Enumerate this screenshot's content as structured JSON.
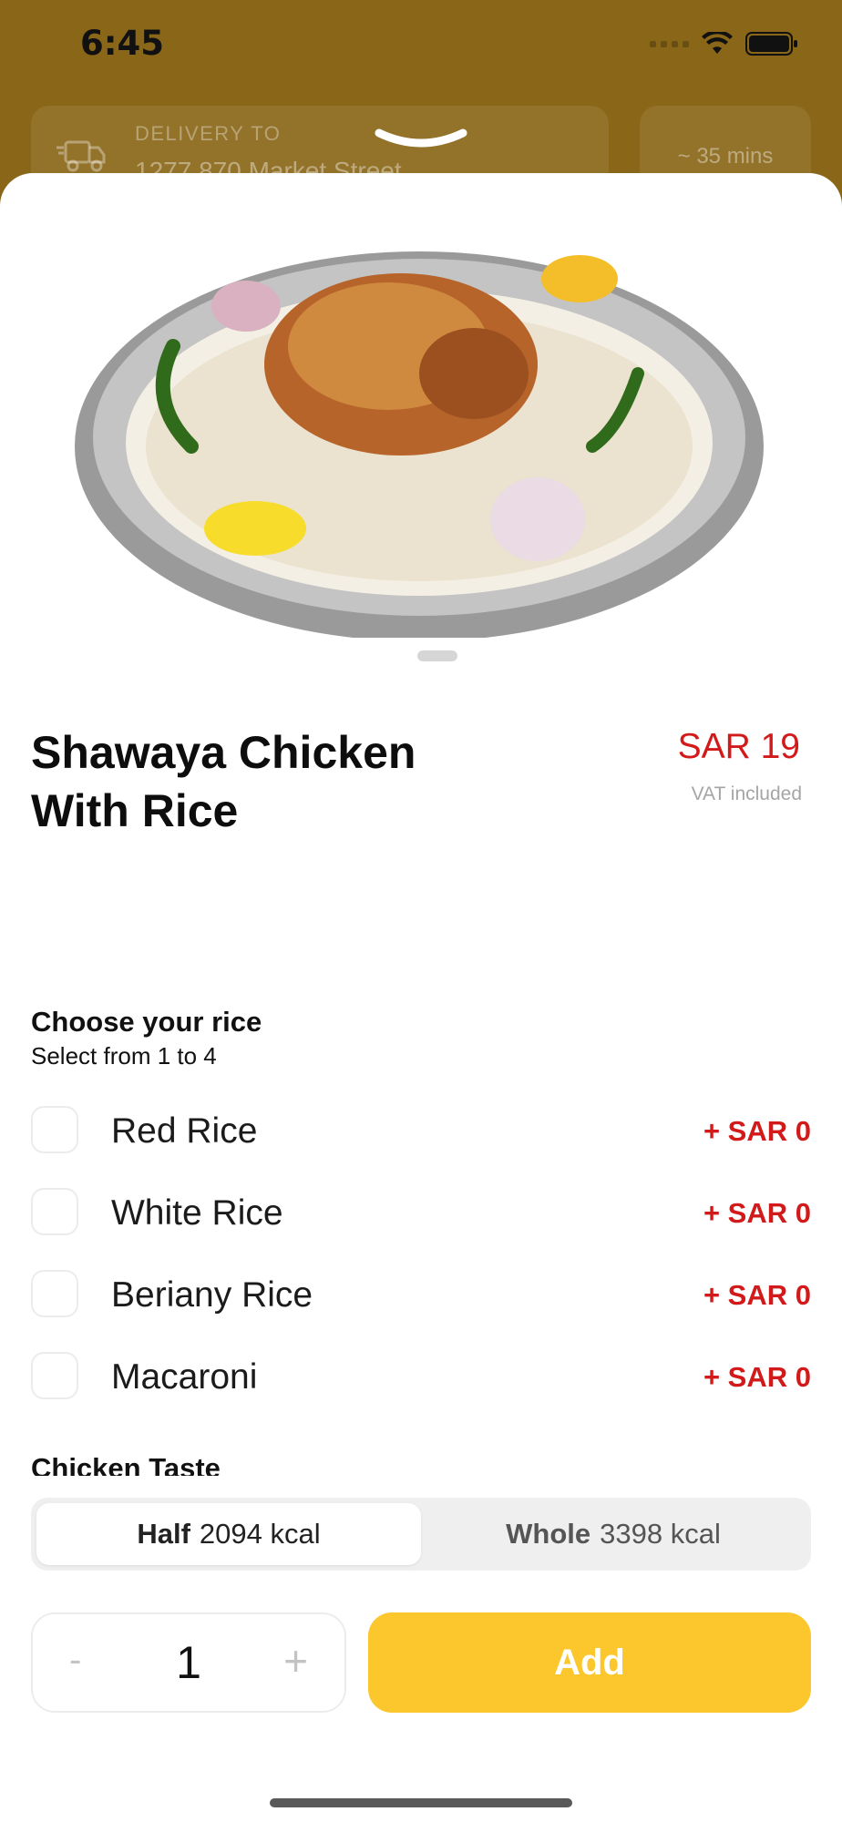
{
  "status": {
    "time": "6:45"
  },
  "header": {
    "delivery_label": "DELIVERY TO",
    "address": "1277 870 Market Street",
    "eta": "~ 35 mins"
  },
  "product": {
    "name": "Shawaya Chicken With Rice",
    "price": "SAR 19",
    "vat_note": "VAT included"
  },
  "rice_section": {
    "title": "Choose your rice",
    "subtitle": "Select from 1 to 4",
    "options": [
      {
        "label": "Red Rice",
        "price": "+  SAR 0"
      },
      {
        "label": "White Rice",
        "price": "+  SAR 0"
      },
      {
        "label": "Beriany Rice",
        "price": "+  SAR 0"
      },
      {
        "label": "Macaroni",
        "price": "+  SAR 0"
      }
    ]
  },
  "taste_section": {
    "title": "Chicken Taste"
  },
  "size_selector": {
    "half_label": "Half",
    "half_kcal": "2094 kcal",
    "whole_label": "Whole",
    "whole_kcal": "3398 kcal",
    "selected": "Half"
  },
  "quantity": {
    "minus": "-",
    "value": "1",
    "plus": "+"
  },
  "add_button": {
    "label": "Add"
  },
  "colors": {
    "accent": "#fcc62d",
    "price_red": "#d31a1a",
    "backdrop": "#8a6618"
  }
}
